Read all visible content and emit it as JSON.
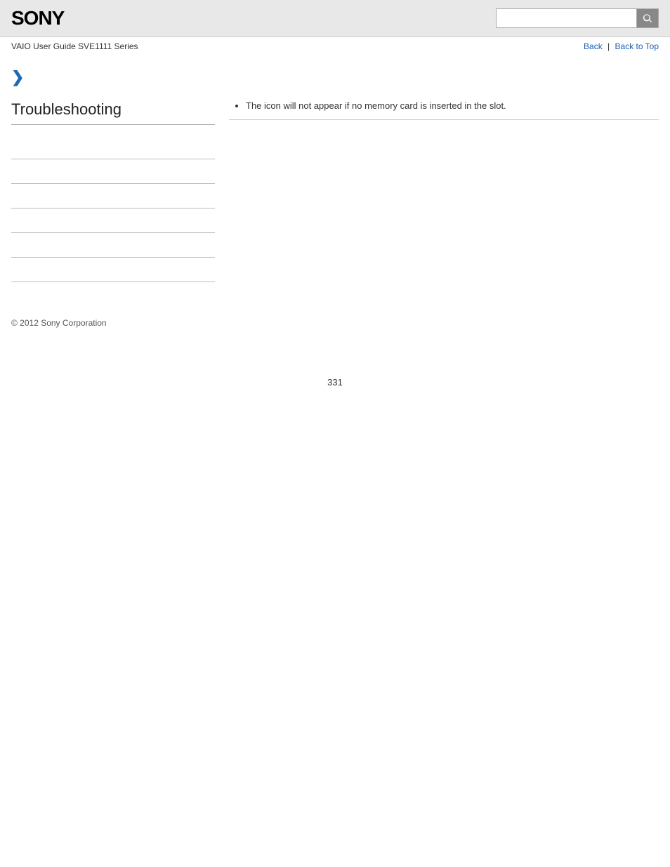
{
  "header": {
    "logo": "SONY",
    "search_placeholder": ""
  },
  "nav": {
    "breadcrumb": "VAIO User Guide SVE1111 Series",
    "back_link": "Back",
    "back_to_top_link": "Back to Top",
    "separator": "|"
  },
  "chevron": "❯",
  "sidebar": {
    "section_title": "Troubleshooting",
    "links": [
      {
        "label": ""
      },
      {
        "label": ""
      },
      {
        "label": ""
      },
      {
        "label": ""
      },
      {
        "label": ""
      },
      {
        "label": ""
      }
    ]
  },
  "content": {
    "bullet_item": "The icon will not appear if no memory card is inserted in the slot."
  },
  "footer": {
    "copyright": "© 2012 Sony Corporation"
  },
  "page_number": "331"
}
